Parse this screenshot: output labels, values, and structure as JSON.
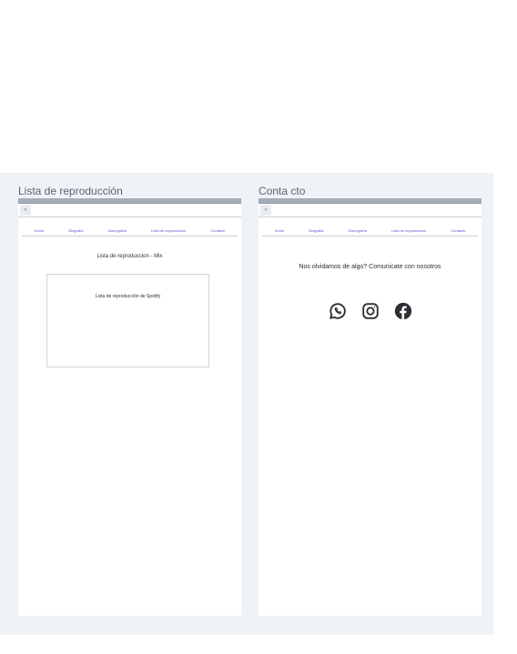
{
  "boards": [
    {
      "title": "Lista de reproducción",
      "tab_label": "✕",
      "nav": [
        "Home",
        "Biografía",
        "Discografía",
        "Lista de reproducción",
        "Contacto"
      ],
      "heading": "Lista de reproduccion - Mix",
      "box_label": "Lista de reproducción de Spotify"
    },
    {
      "title": "Conta cto",
      "tab_label": "✕",
      "nav": [
        "Home",
        "Biografía",
        "Discografía",
        "Lista de reproduccion",
        "Contacto"
      ],
      "heading": "Nos olvidamos de algo? Comunicate con nosotros",
      "social_icons": [
        "whatsapp-icon",
        "instagram-icon",
        "facebook-icon"
      ]
    }
  ],
  "colors": {
    "canvas": "#eff3f7",
    "nav_link": "#5b55d9",
    "icon": "#2c2f33"
  }
}
